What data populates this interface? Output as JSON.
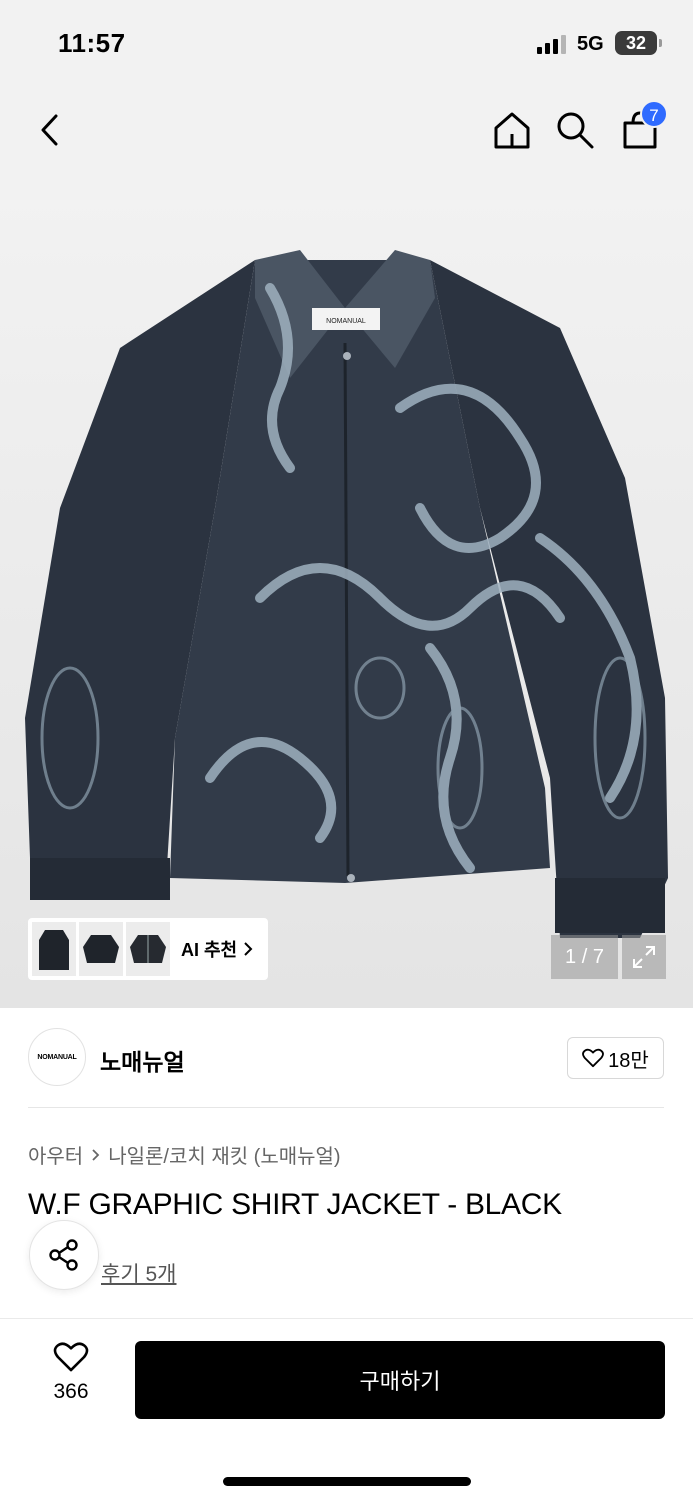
{
  "status_bar": {
    "time": "11:57",
    "network": "5G",
    "battery": "32"
  },
  "nav": {
    "cart_count": "7"
  },
  "hero": {
    "tag_text": "NOMANUAL",
    "ai_label": "AI 추천",
    "image_counter": "1 / 7"
  },
  "brand": {
    "logo_text": "NOMANUAL",
    "name": "노매뉴얼",
    "like_count": "18만"
  },
  "product": {
    "breadcrumb": [
      "아우터",
      "나일론/코치 재킷 (노매뉴얼)"
    ],
    "title": "W.F GRAPHIC SHIRT JACKET - BLACK",
    "review_text": "후기 5개"
  },
  "bottom": {
    "wish_count": "366",
    "buy_label": "구매하기"
  },
  "colors": {
    "accent_blue": "#2f6bff",
    "jacket": "#2b3340",
    "print": "#9fb1bf"
  },
  "icons": [
    "back-icon",
    "home-icon",
    "search-icon",
    "cart-icon",
    "chevron-right-icon",
    "expand-icon",
    "heart-icon",
    "share-icon"
  ]
}
